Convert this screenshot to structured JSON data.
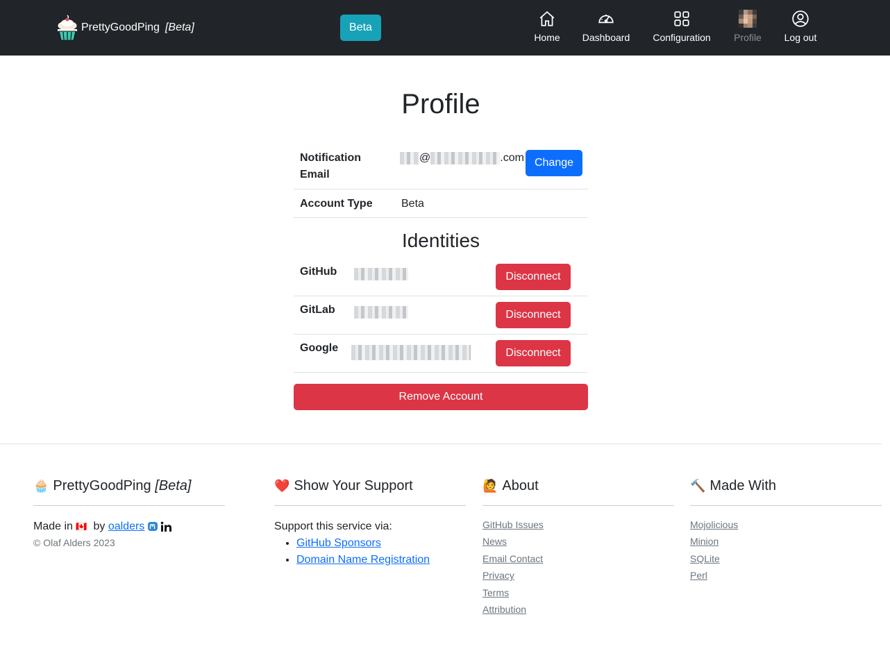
{
  "navbar": {
    "brand_name": "PrettyGoodPing",
    "brand_tag": "[Beta]",
    "beta_button": "Beta",
    "items": [
      {
        "label": "Home",
        "icon": "house-icon"
      },
      {
        "label": "Dashboard",
        "icon": "speedometer-icon"
      },
      {
        "label": "Configuration",
        "icon": "grid-icon"
      },
      {
        "label": "Profile",
        "icon": "avatar"
      },
      {
        "label": "Log out",
        "icon": "user-circle-icon"
      }
    ]
  },
  "page": {
    "title": "Profile",
    "notification_label": "Notification Email",
    "email_at": "@",
    "email_suffix": ".com",
    "change_button": "Change",
    "account_type_label": "Account Type",
    "account_type_value": "Beta",
    "identities_title": "Identities",
    "identities": [
      {
        "provider": "GitHub",
        "action": "Disconnect"
      },
      {
        "provider": "GitLab",
        "action": "Disconnect"
      },
      {
        "provider": "Google",
        "action": "Disconnect"
      }
    ],
    "remove_account_button": "Remove Account"
  },
  "footer": {
    "brand": {
      "emoji": "🧁",
      "name": "PrettyGoodPing",
      "tag": "[Beta]",
      "made_in": "Made in",
      "flag": "🇨🇦",
      "by": "by",
      "author_link": "oalders",
      "copyright": "© Olaf Alders 2023"
    },
    "support": {
      "emoji": "❤️",
      "title": "Show Your Support",
      "intro": "Support this service via:",
      "links": [
        "GitHub Sponsors",
        "Domain Name Registration"
      ]
    },
    "about": {
      "emoji": "🙋",
      "title": "About",
      "links": [
        "GitHub Issues",
        "News",
        "Email Contact",
        "Privacy",
        "Terms",
        "Attribution"
      ]
    },
    "made_with": {
      "emoji": "🔨",
      "title": "Made With",
      "links": [
        "Mojolicious",
        "Minion",
        "SQLite",
        "Perl"
      ]
    }
  },
  "colors": {
    "navbar": "#212529",
    "primary": "#0d6efd",
    "danger": "#dc3545",
    "info": "#17a2b8"
  }
}
